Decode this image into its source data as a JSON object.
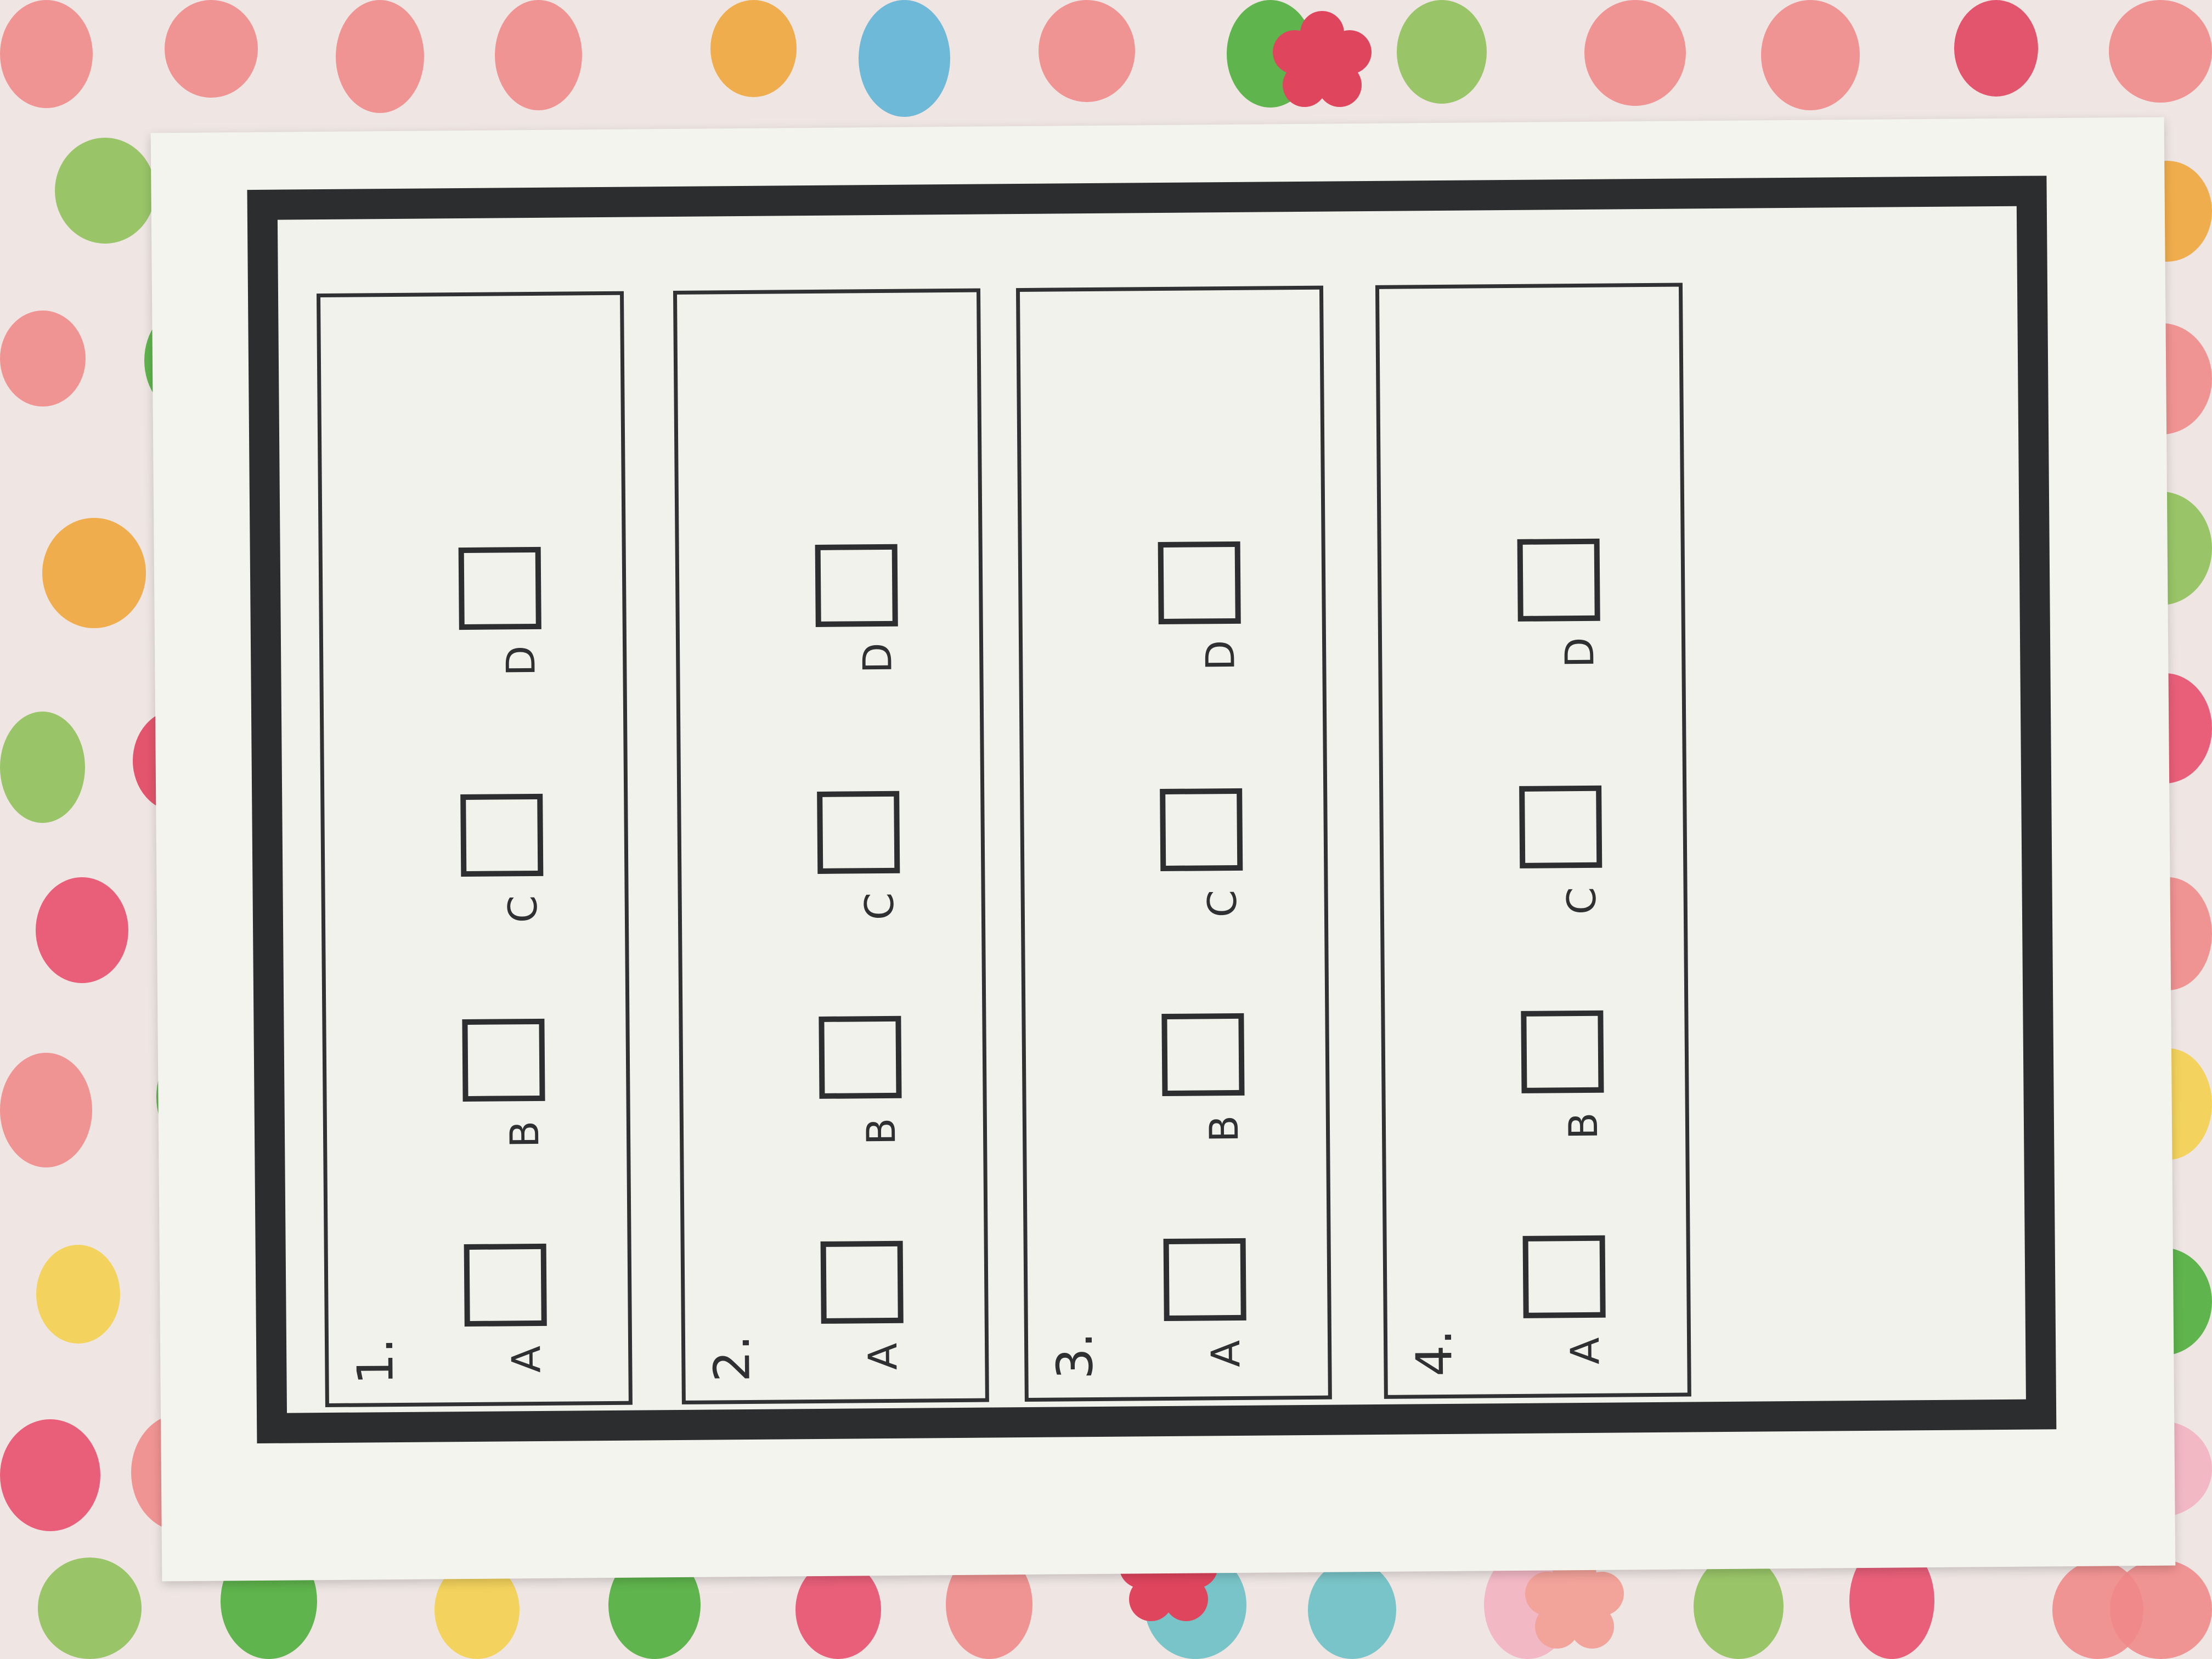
{
  "worksheet": {
    "questions": [
      {
        "number": "1.",
        "options": [
          "A",
          "B",
          "C",
          "D"
        ]
      },
      {
        "number": "2.",
        "options": [
          "A",
          "B",
          "C",
          "D"
        ]
      },
      {
        "number": "3.",
        "options": [
          "A",
          "B",
          "C",
          "D"
        ]
      },
      {
        "number": "4.",
        "options": [
          "A",
          "B",
          "C",
          "D"
        ]
      }
    ]
  },
  "colors": {
    "tablecloth": "#efe6e4",
    "paper": "#f4f4ef",
    "frame": "#2b2d2e",
    "dots": [
      "#e8506e",
      "#f0a63c",
      "#8fc15a",
      "#6cc0c4",
      "#f08a8a",
      "#5fb3d6",
      "#e0455e",
      "#4fae3c",
      "#f3d04e",
      "#f2b3c0"
    ]
  }
}
